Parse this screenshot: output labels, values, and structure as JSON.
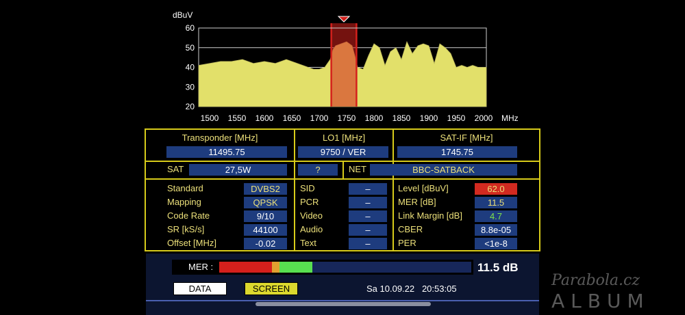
{
  "chart_data": {
    "type": "area",
    "ylabel": "dBuV",
    "xlabel": "MHz",
    "ylim": [
      20,
      60
    ],
    "xlim": [
      1480,
      2005
    ],
    "yticks": [
      "20",
      "30",
      "40",
      "50",
      "60"
    ],
    "xticks": [
      "1500",
      "1550",
      "1600",
      "1650",
      "1700",
      "1750",
      "1800",
      "1850",
      "1900",
      "1950",
      "2000"
    ],
    "grid": true,
    "series_color": "#e2e06a",
    "marker_color": "#d4201c",
    "marker_range": [
      1722,
      1768
    ],
    "x": [
      1480,
      1500,
      1520,
      1540,
      1560,
      1580,
      1600,
      1620,
      1640,
      1660,
      1680,
      1690,
      1700,
      1710,
      1720,
      1725,
      1730,
      1740,
      1750,
      1760,
      1765,
      1770,
      1780,
      1790,
      1800,
      1810,
      1820,
      1830,
      1840,
      1850,
      1860,
      1870,
      1880,
      1890,
      1900,
      1910,
      1920,
      1930,
      1940,
      1950,
      1960,
      1970,
      1980,
      1990,
      2000,
      2005
    ],
    "values": [
      41,
      42,
      43,
      43,
      44,
      42,
      43,
      42,
      44,
      42,
      40,
      39,
      39,
      40,
      44,
      49,
      51,
      52,
      53,
      51,
      46,
      40,
      39,
      46,
      52,
      50,
      41,
      48,
      50,
      44,
      53,
      47,
      51,
      52,
      51,
      42,
      52,
      50,
      47,
      40,
      41,
      40,
      41,
      40,
      40,
      40
    ]
  },
  "panel": {
    "transponder_label": "Transponder [MHz]",
    "transponder_value": "11495.75",
    "lo1_label": "LO1 [MHz]",
    "lo1_value": "9750 / VER",
    "satif_label": "SAT-IF [MHz]",
    "satif_value": "1745.75",
    "sat_label": "SAT",
    "sat_value": "27,5W",
    "q_value": "?",
    "net_label": "NET",
    "net_value": "BBC-SATBACK"
  },
  "left_params": [
    {
      "label": "Standard",
      "value": "DVBS2"
    },
    {
      "label": "Mapping",
      "value": "QPSK"
    },
    {
      "label": "Code Rate",
      "value": "9/10"
    },
    {
      "label": "SR [kS/s]",
      "value": "44100"
    },
    {
      "label": "Offset [MHz]",
      "value": "-0.02"
    }
  ],
  "mid_params": [
    {
      "label": "SID",
      "value": "–"
    },
    {
      "label": "PCR",
      "value": "–"
    },
    {
      "label": "Video",
      "value": "–"
    },
    {
      "label": "Audio",
      "value": "–"
    },
    {
      "label": "Text",
      "value": "–"
    }
  ],
  "right_params": [
    {
      "label": "Level [dBuV]",
      "value": "62.0"
    },
    {
      "label": "MER [dB]",
      "value": "11.5"
    },
    {
      "label": "Link Margin [dB]",
      "value": "4.7"
    },
    {
      "label": "CBER",
      "value": "8.8e-05"
    },
    {
      "label": "PER",
      "value": "<1e-8"
    }
  ],
  "mer_bar": {
    "label": "MER :",
    "value_text": "11.5 dB",
    "red_fraction": 0.21,
    "orange_fraction": 0.03,
    "green_fraction": 0.13,
    "colors": {
      "red": "#d4201c",
      "orange": "#e0a030",
      "green": "#58e050",
      "track": "#17275a"
    }
  },
  "buttons": {
    "data": "DATA",
    "screen": "SCREEN"
  },
  "datetime": "Sa 10.09.22   20:53:05",
  "watermark": {
    "line1": "Parabola.cz",
    "line2": "ALBUM"
  }
}
